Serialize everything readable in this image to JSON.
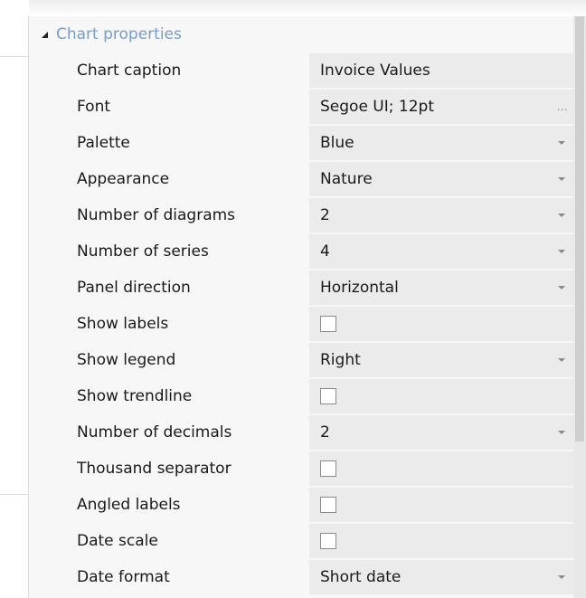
{
  "category": {
    "label": "Chart properties"
  },
  "properties": [
    {
      "name": "Chart caption",
      "value": "Invoice Values",
      "kind": "text"
    },
    {
      "name": "Font",
      "value": "Segoe UI; 12pt",
      "kind": "ellipsis",
      "button": "..."
    },
    {
      "name": "Palette",
      "value": "Blue",
      "kind": "dropdown"
    },
    {
      "name": "Appearance",
      "value": "Nature",
      "kind": "dropdown"
    },
    {
      "name": "Number of diagrams",
      "value": "2",
      "kind": "dropdown"
    },
    {
      "name": "Number of series",
      "value": "4",
      "kind": "dropdown"
    },
    {
      "name": "Panel direction",
      "value": "Horizontal",
      "kind": "dropdown"
    },
    {
      "name": "Show labels",
      "checked": false,
      "kind": "checkbox"
    },
    {
      "name": "Show legend",
      "value": "Right",
      "kind": "dropdown"
    },
    {
      "name": "Show trendline",
      "checked": false,
      "kind": "checkbox"
    },
    {
      "name": "Number of decimals",
      "value": "2",
      "kind": "dropdown"
    },
    {
      "name": "Thousand separator",
      "checked": false,
      "kind": "checkbox"
    },
    {
      "name": "Angled labels",
      "checked": false,
      "kind": "checkbox"
    },
    {
      "name": "Date scale",
      "checked": false,
      "kind": "checkbox"
    },
    {
      "name": "Date format",
      "value": "Short date",
      "kind": "dropdown"
    }
  ]
}
